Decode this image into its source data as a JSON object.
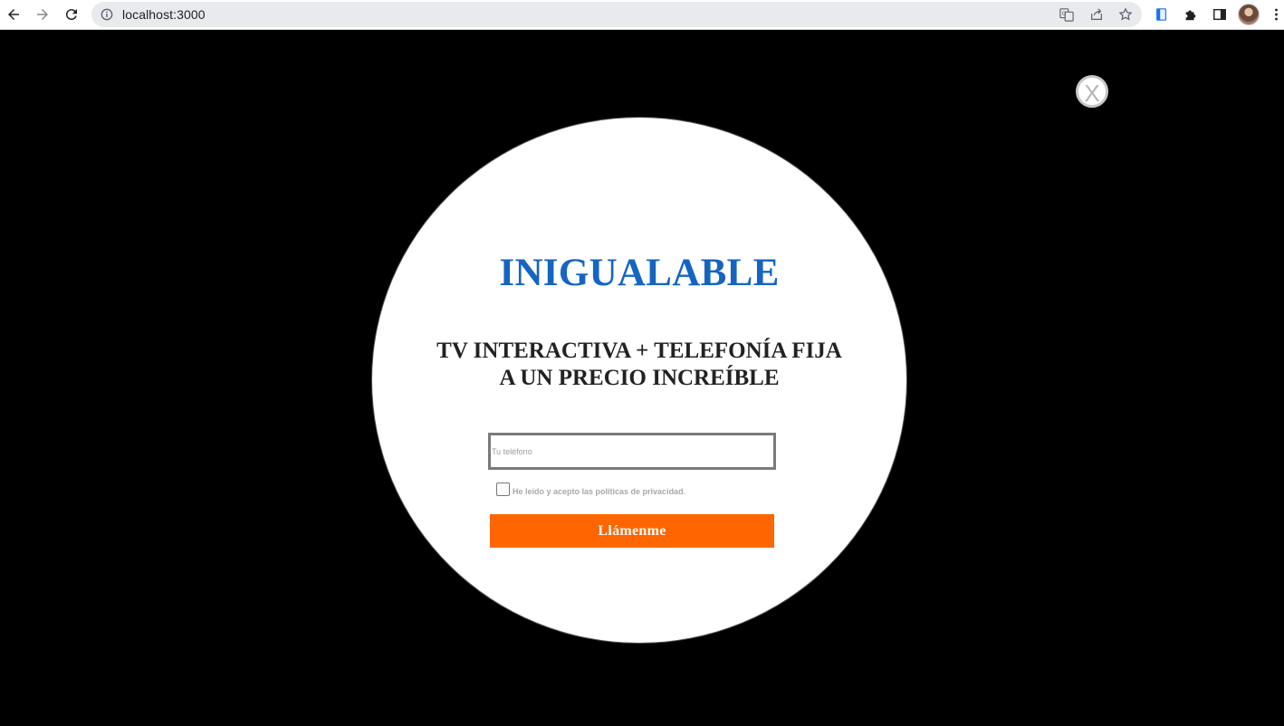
{
  "browser": {
    "url": "localhost:3000"
  },
  "modal": {
    "close_label": "X",
    "headline": "INIGUALABLE",
    "subheadline_line1": "TV INTERACTIVA + TELEFONÍA FIJA",
    "subheadline_line2": "A UN PRECIO INCREÍBLE",
    "phone_placeholder": "Tu teléfono",
    "phone_value": "",
    "consent_label": "He leído y acepto las políticas de privacidad.",
    "consent_checked": false,
    "submit_label": "Llámenme"
  },
  "colors": {
    "headline": "#1565c0",
    "button": "#ff6600",
    "backdrop": "#000000"
  },
  "icons": [
    "back-arrow-icon",
    "forward-arrow-icon",
    "reload-icon",
    "site-info-icon",
    "translate-icon",
    "share-icon",
    "bookmark-star-icon",
    "extension-doc-icon",
    "extensions-puzzle-icon",
    "side-panel-icon",
    "profile-avatar",
    "more-menu-icon"
  ]
}
